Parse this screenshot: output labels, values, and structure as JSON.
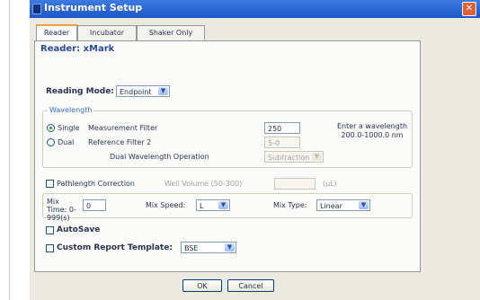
{
  "window": {
    "title": "Instrument Setup",
    "close_icon": "close-icon"
  },
  "tabs": [
    {
      "label": "Reader",
      "active": true
    },
    {
      "label": "Incubator",
      "active": false
    },
    {
      "label": "Shaker Only",
      "active": false
    }
  ],
  "panel": {
    "title": "Reader: xMark",
    "reading_mode": {
      "label": "Reading Mode:",
      "value": "Endpoint"
    },
    "wavelength": {
      "legend": "Wavelength",
      "single_label": "Single",
      "dual_label": "Dual",
      "measurement_filter": {
        "label": "Measurement Filter",
        "value": "250"
      },
      "reference_filter": {
        "label": "Reference Filter 2",
        "value": "5-0"
      },
      "dual_operation": {
        "label": "Dual Wavelength Operation",
        "value": "Subtraction"
      },
      "hint": "Enter a wavelength 200.0-1000.0 nm"
    },
    "pathlength": {
      "label": "Pathlength Correction",
      "well_volume_label": "Well Volume (50-300)",
      "well_volume_value": "",
      "unit": "(µL)"
    },
    "mix": {
      "time_label": "Mix Time: 0-999(s)",
      "time_value": "0",
      "speed_label": "Mix Speed:",
      "speed_value": "L",
      "type_label": "Mix Type:",
      "type_value": "Linear"
    },
    "autosave_label": "AutoSave",
    "custom_report": {
      "label": "Custom Report Template:",
      "value": "BSE"
    }
  },
  "buttons": {
    "ok": "OK",
    "cancel": "Cancel"
  }
}
